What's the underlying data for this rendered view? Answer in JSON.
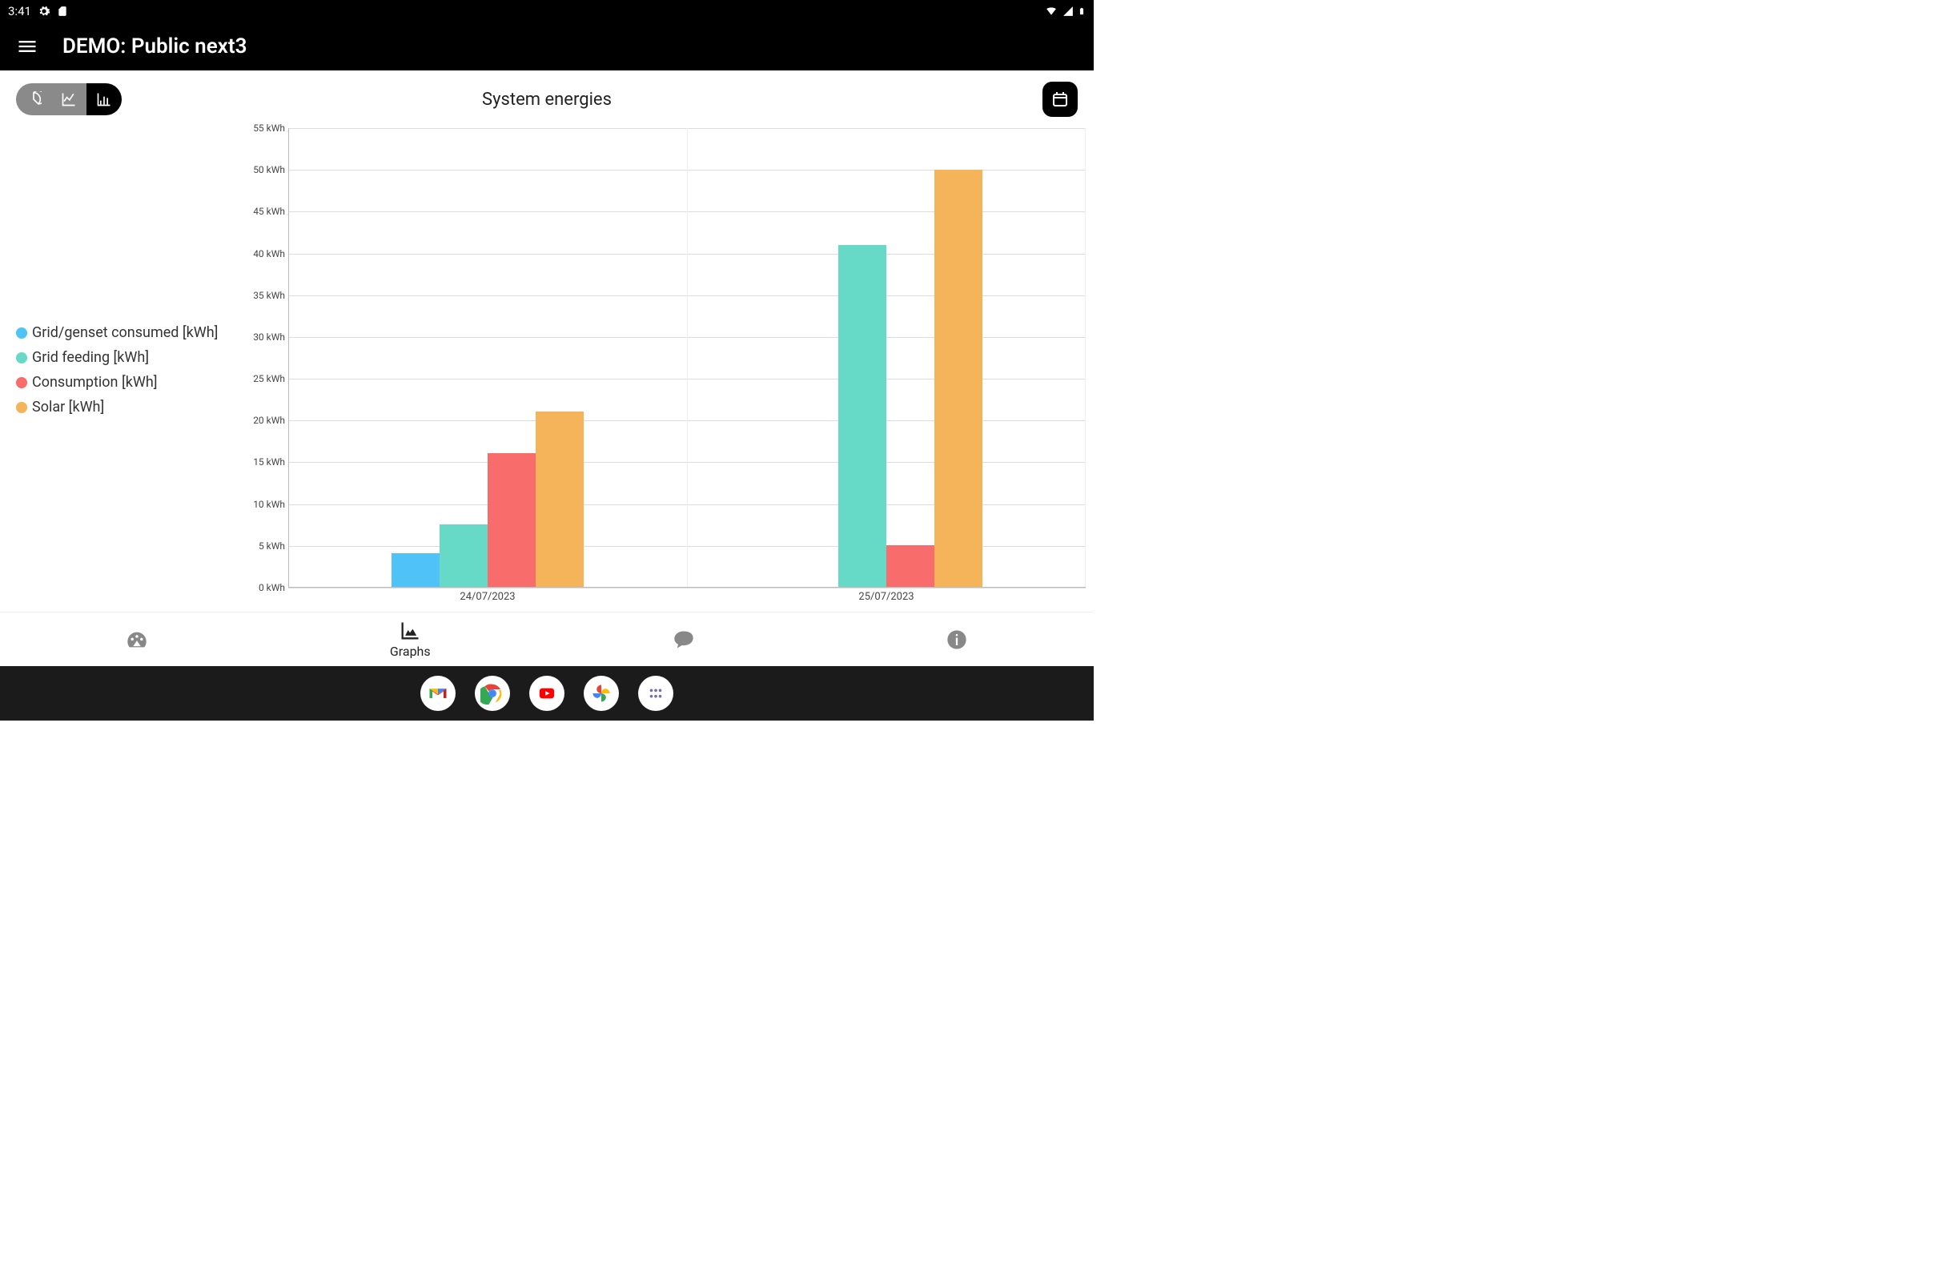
{
  "status_bar": {
    "time": "3:41"
  },
  "app": {
    "title": "DEMO: Public next3"
  },
  "page": {
    "title": "System energies"
  },
  "nav": {
    "dashboard": "",
    "graphs": "Graphs",
    "messages": "",
    "info": ""
  },
  "chart_data": {
    "type": "bar",
    "title": "System energies",
    "xlabel": "",
    "ylabel": "",
    "y_unit": "kWh",
    "ylim": [
      0,
      55
    ],
    "y_ticks": [
      0,
      5,
      10,
      15,
      20,
      25,
      30,
      35,
      40,
      45,
      50,
      55
    ],
    "y_tick_labels": [
      "0 kWh",
      "5 kWh",
      "10 kWh",
      "15 kWh",
      "20 kWh",
      "25 kWh",
      "30 kWh",
      "35 kWh",
      "40 kWh",
      "45 kWh",
      "50 kWh",
      "55 kWh"
    ],
    "categories": [
      "24/07/2023",
      "25/07/2023"
    ],
    "series": [
      {
        "name": "Grid/genset consumed [kWh]",
        "color": "#4fc3f7",
        "values": [
          4,
          0
        ]
      },
      {
        "name": "Grid feeding [kWh]",
        "color": "#66d9c7",
        "values": [
          7.5,
          41
        ]
      },
      {
        "name": "Consumption [kWh]",
        "color": "#f86c6c",
        "values": [
          16,
          5
        ]
      },
      {
        "name": "Solar [kWh]",
        "color": "#f6b45a",
        "values": [
          21,
          50
        ]
      }
    ]
  }
}
